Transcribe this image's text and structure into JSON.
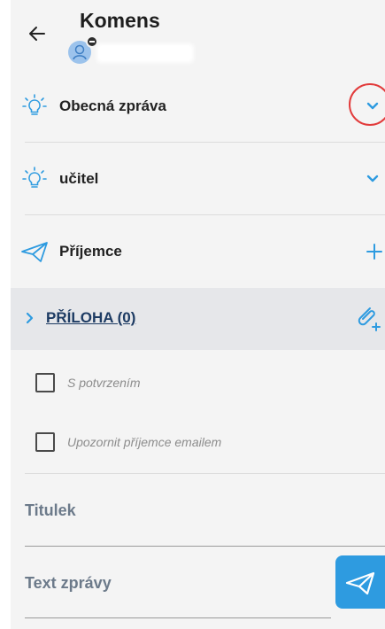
{
  "header": {
    "title": "Komens"
  },
  "rows": {
    "message_type": "Obecná zpráva",
    "role": "učitel",
    "recipients": "Příjemce"
  },
  "attachments": {
    "label": "PŘÍLOHA (0)"
  },
  "options": {
    "confirmation": "S potvrzením",
    "notify_email": "Upozornit příjemce emailem"
  },
  "fields": {
    "subject": "Titulek",
    "body": "Text zprávy"
  },
  "colors": {
    "accent": "#2e9be0",
    "navy": "#1d3b63",
    "highlight_circle": "#e23b3b"
  }
}
